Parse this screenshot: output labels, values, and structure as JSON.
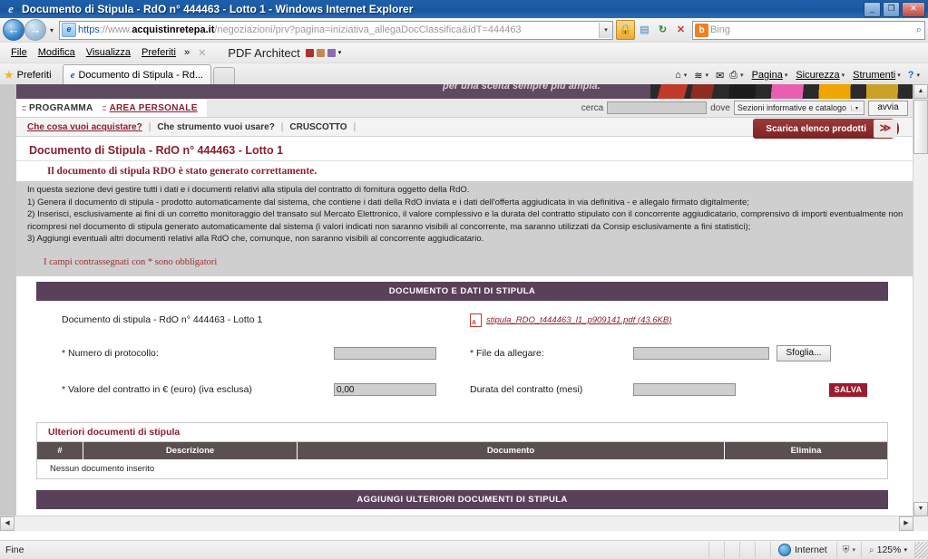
{
  "window": {
    "title": "Documento di Stipula - RdO n° 444463 - Lotto 1 - Windows Internet Explorer",
    "minimize": "_",
    "maximize": "❐",
    "close": "✕"
  },
  "browser": {
    "back_icon": "←",
    "forward_icon": "→",
    "history_dropdown_icon": "▾",
    "url_scheme": "https",
    "url_sep": "://www.",
    "url_domain": "acquistinretepa.it",
    "url_path": "/negoziazioni/prv?pagina=iniziativa_allegaDocClassifica&idT=444463",
    "url_dropdown_icon": "▾",
    "lock_icon": "🔒",
    "compat_icon": "▤",
    "refresh_icon": "↻",
    "stop_icon": "✕",
    "search_engine_badge": "b",
    "search_placeholder": "Bing",
    "search_magnifier_icon": "⌕",
    "menu": [
      "File",
      "Modifica",
      "Visualizza",
      "Preferiti"
    ],
    "menu_overflow_icon": "»",
    "menu_close_icon": "✕",
    "pdf_addon": "PDF Architect",
    "pdf_addon_dropdown_icon": "▾",
    "favorites_label": "Preferiti",
    "favorites_star_icon": "★",
    "tab_label": "Documento di Stipula - Rd...",
    "tab_ie_icon": "e",
    "command_items": [
      "Pagina",
      "Sicurezza",
      "Strumenti"
    ],
    "cmd_home_icon": "⌂",
    "cmd_feed_icon": "≋",
    "cmd_mail_icon": "✉",
    "cmd_print_icon": "⎙",
    "cmd_help_icon": "?",
    "cmd_dropdown_icon": "▾"
  },
  "banner": {
    "tagline": "per una scelta sempre più ampia."
  },
  "topnav": {
    "dots_icon": "::",
    "programma": "PROGRAMMA",
    "area_personale": "AREA PERSONALE"
  },
  "search": {
    "cerca_label": "cerca",
    "query_value": "",
    "dove_label": "dove",
    "scope_selected": "Sezioni informative e catalogo",
    "scope_dropdown_icon": "▾",
    "go_label": "avvia"
  },
  "subnav": {
    "items": [
      {
        "label": "Che cosa vuoi acquistare?",
        "active": true
      },
      {
        "label": "Che strumento vuoi usare?",
        "active": false
      },
      {
        "label": "CRUSCOTTO",
        "active": false
      }
    ],
    "separator": "|",
    "download_button": "Scarica elenco prodotti",
    "download_chevron_icon": "⌄"
  },
  "page": {
    "title": "Documento di Stipula - RdO n° 444463 - Lotto 1",
    "success_message": "Il documento di stipula RDO è stato generato correttamente.",
    "intro_lines": [
      "In questa sezione devi gestire tutti i dati e i documenti relativi alla stipula del contratto di fornitura oggetto della RdO.",
      "1) Genera il documento di stipula - prodotto automaticamente dal sistema, che contiene i dati della RdO inviata e i dati dell'offerta aggiudicata in via definitiva - e allegalo firmato digitalmente;",
      "2) Inserisci, esclusivamente ai fini di un corretto monitoraggio del transato sul Mercato Elettronico, il valore complessivo e la durata del contratto stipulato con il concorrente aggiudicatario, comprensivo di importi eventualmente non ricompresi nel documento di stipula generato automaticamente dal sistema (i valori indicati non saranno visibili al concorrente, ma saranno utilizzati da Consip esclusivamente a fini statistici);",
      "3) Aggiungi eventuali altri documenti relativi alla RdO che, comunque, non saranno visibili al concorrente aggiudicatario."
    ],
    "required_note": "I campi contrassegnati con * sono obbligatori"
  },
  "doc_section": {
    "header": "DOCUMENTO E DATI DI STIPULA",
    "doc_label": "Documento di stipula - RdO n° 444463 - Lotto 1",
    "pdf_icon": "pdf-icon",
    "pdf_filename": "stipula_RDO_t444463_l1_p909141.pdf (43.6KB)",
    "protocollo_label": "* Numero di protocollo:",
    "protocollo_value": "",
    "file_label": "* File da allegare:",
    "file_value": "",
    "browse_button": "Sfoglia...",
    "valore_label": "* Valore del contratto in € (euro) (iva esclusa)",
    "valore_value": "0,00",
    "durata_label": "Durata del contratto (mesi)",
    "durata_value": "",
    "save_button": "SALVA"
  },
  "docs_table": {
    "title": "Ulteriori documenti di stipula",
    "columns": [
      "#",
      "Descrizione",
      "Documento",
      "Elimina"
    ],
    "empty_message": "Nessun documento inserito"
  },
  "add_section": {
    "header": "AGGIUNGI ULTERIORI DOCUMENTI DI STIPULA"
  },
  "statusbar": {
    "text": "Fine",
    "zone_label": "Internet",
    "zone_icon": "globe-icon",
    "protected_icon": "⛨",
    "protected_dropdown_icon": "▾",
    "zoom_icon": "⌕",
    "zoom_level": "125%",
    "zoom_dropdown_icon": "▾"
  },
  "scrollbars": {
    "up_icon": "▲",
    "down_icon": "▼",
    "left_icon": "◀",
    "right_icon": "▶"
  },
  "colors": {
    "brand_red": "#8a1f2f",
    "section_purple": "#594159",
    "table_header": "#5a5050",
    "title_blue": "#1a5ba4"
  }
}
